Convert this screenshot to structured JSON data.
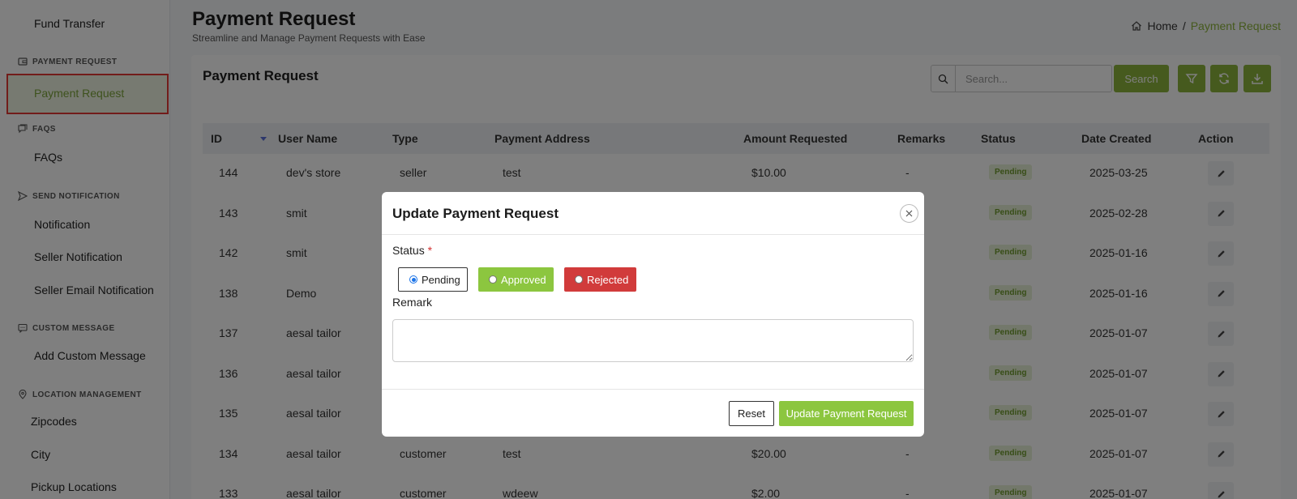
{
  "sidebar": {
    "fund_transfer": "Fund Transfer",
    "sections": {
      "payment_request": "PAYMENT REQUEST",
      "faqs": "FAQS",
      "send_notification": "SEND NOTIFICATION",
      "custom_message": "CUSTOM MESSAGE",
      "location_management": "LOCATION MANAGEMENT"
    },
    "items": {
      "payment_request": "Payment Request",
      "faqs": "FAQs",
      "notification": "Notification",
      "seller_notification": "Seller Notification",
      "seller_email_notification": "Seller Email Notification",
      "add_custom_message": "Add Custom Message",
      "zipcodes": "Zipcodes",
      "city": "City",
      "pickup_locations": "Pickup Locations"
    }
  },
  "header": {
    "title": "Payment Request",
    "subtitle": "Streamline and Manage Payment Requests with Ease",
    "breadcrumb": {
      "home": "Home",
      "separator": "/",
      "current": "Payment Request"
    }
  },
  "card": {
    "title": "Payment Request",
    "search_placeholder": "Search...",
    "search_button": "Search"
  },
  "table": {
    "columns": [
      "ID",
      "User Name",
      "Type",
      "Payment Address",
      "Amount Requested",
      "Remarks",
      "Status",
      "Date Created",
      "Action"
    ],
    "rows": [
      {
        "id": "144",
        "user": "dev's store",
        "type": "seller",
        "address": "test",
        "amount": "$10.00",
        "remarks": "-",
        "status": "Pending",
        "date": "2025-03-25"
      },
      {
        "id": "143",
        "user": "smit",
        "type": "",
        "address": "",
        "amount": "",
        "remarks": "",
        "status": "Pending",
        "date": "2025-02-28"
      },
      {
        "id": "142",
        "user": "smit",
        "type": "",
        "address": "",
        "amount": "",
        "remarks": "",
        "status": "Pending",
        "date": "2025-01-16"
      },
      {
        "id": "138",
        "user": "Demo",
        "type": "",
        "address": "",
        "amount": "",
        "remarks": "",
        "status": "Pending",
        "date": "2025-01-16"
      },
      {
        "id": "137",
        "user": "aesal tailor",
        "type": "",
        "address": "",
        "amount": "",
        "remarks": "",
        "status": "Pending",
        "date": "2025-01-07"
      },
      {
        "id": "136",
        "user": "aesal tailor",
        "type": "",
        "address": "",
        "amount": "",
        "remarks": "",
        "status": "Pending",
        "date": "2025-01-07"
      },
      {
        "id": "135",
        "user": "aesal tailor",
        "type": "",
        "address": "",
        "amount": "",
        "remarks": "",
        "status": "Pending",
        "date": "2025-01-07"
      },
      {
        "id": "134",
        "user": "aesal tailor",
        "type": "customer",
        "address": "test",
        "amount": "$20.00",
        "remarks": "-",
        "status": "Pending",
        "date": "2025-01-07"
      },
      {
        "id": "133",
        "user": "aesal tailor",
        "type": "customer",
        "address": "wdeew",
        "amount": "$2.00",
        "remarks": "-",
        "status": "Pending",
        "date": "2025-01-07"
      }
    ]
  },
  "modal": {
    "title": "Update Payment Request",
    "status_label": "Status",
    "required_mark": "*",
    "options": {
      "pending": "Pending",
      "approved": "Approved",
      "rejected": "Rejected"
    },
    "selected": "pending",
    "remark_label": "Remark",
    "remark_value": "",
    "reset_button": "Reset",
    "update_button": "Update Payment Request"
  },
  "colors": {
    "accent": "#8cb43c",
    "approved": "#8cc63f",
    "rejected": "#d13b3b",
    "highlight_border": "#e53935"
  }
}
